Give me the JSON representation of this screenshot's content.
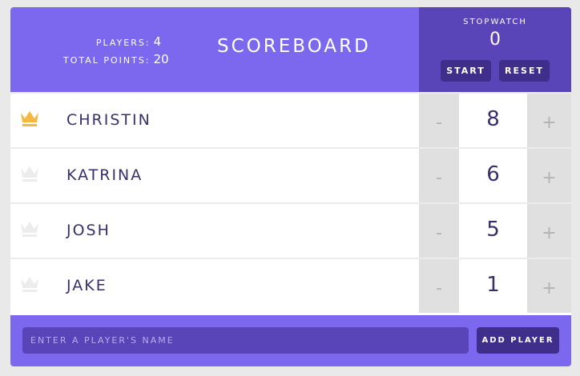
{
  "header": {
    "players_label": "PLAYERS:",
    "players_value": "4",
    "points_label": "TOTAL POINTS:",
    "points_value": "20",
    "title": "SCOREBOARD"
  },
  "stopwatch": {
    "label": "STOPWATCH",
    "time": "0",
    "start_label": "START",
    "reset_label": "RESET"
  },
  "players": [
    {
      "name": "CHRISTIN",
      "score": "8",
      "leader": true
    },
    {
      "name": "KATRINA",
      "score": "6",
      "leader": false
    },
    {
      "name": "JOSH",
      "score": "5",
      "leader": false
    },
    {
      "name": "JAKE",
      "score": "1",
      "leader": false
    }
  ],
  "controls": {
    "minus": "-",
    "plus": "+"
  },
  "footer": {
    "placeholder": "ENTER A PLAYER'S NAME",
    "add_label": "ADD PLAYER"
  },
  "colors": {
    "accent": "#7b68ee",
    "accent_dark": "#5a45b8",
    "button": "#3f2f8a",
    "crown_active": "#f5b942",
    "crown_inactive": "#ececec"
  }
}
